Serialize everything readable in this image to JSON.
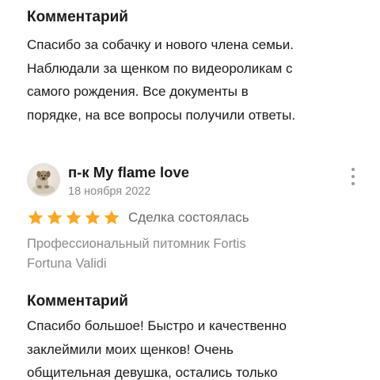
{
  "first_review": {
    "comment_title": "Комментарий",
    "comment_lines": [
      "Спасибо за собачку и нового члена семьи.",
      "Наблюдали за щенком по видеороликам с",
      "самого рождения. Все документы в",
      "порядке, на все вопросы получили ответы."
    ]
  },
  "second_review": {
    "reviewer_name": "п-к My flame love",
    "date": "18 ноября 2022",
    "rating": 5,
    "rating_max": 5,
    "star_color": "#f9a825",
    "deal_status": "Сделка состоялась",
    "kennel_lines": [
      "Профессиональный питомник Fortis",
      "Fortuna Validi"
    ],
    "comment_title": "Комментарий",
    "comment_lines": [
      "Спасибо большое! Быстро и качественно",
      "заклеймили моих щенков! Очень",
      "общительная девушка, остались только"
    ]
  },
  "icons": {
    "more": "more-vertical-icon",
    "star": "star-icon",
    "avatar": "avatar"
  }
}
